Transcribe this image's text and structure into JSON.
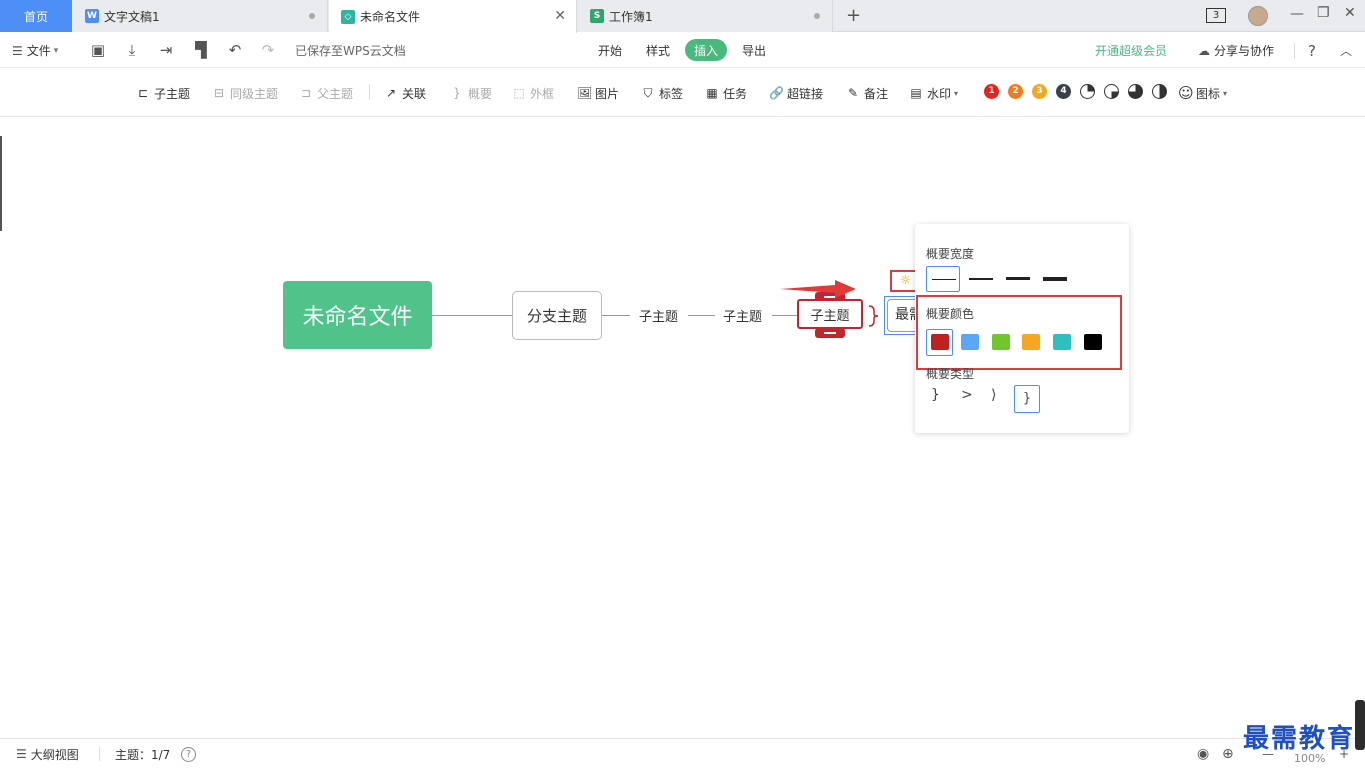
{
  "tabs": {
    "home": "首页",
    "doc1": "文字文稿1",
    "doc2": "未命名文件",
    "doc3": "工作簿1",
    "new_tab": "+",
    "window_count": "3"
  },
  "menu": {
    "file": "文件",
    "saved_status": "已保存至WPS云文档",
    "start": "开始",
    "style": "样式",
    "insert": "插入",
    "export": "导出",
    "vip": "开通超级会员",
    "share": "分享与协作",
    "help": "?"
  },
  "toolbar": {
    "subtopic": "子主题",
    "sibling": "同级主题",
    "parent": "父主题",
    "relation": "关联",
    "summary": "概要",
    "frame": "外框",
    "image": "图片",
    "tag": "标签",
    "task": "任务",
    "hyperlink": "超链接",
    "note": "备注",
    "watermark": "水印",
    "priorities": [
      "1",
      "2",
      "3",
      "4"
    ],
    "priority_colors": [
      "#e5241c",
      "#f57a1b",
      "#f5a623",
      "#3a3f4b"
    ],
    "icon": "图标"
  },
  "mindmap": {
    "root": "未命名文件",
    "branch": "分支主题",
    "sub1": "子主题",
    "sub2": "子主题",
    "selected": "子主题",
    "summary_partial": "最需"
  },
  "panel": {
    "width_label": "概要宽度",
    "color_label": "概要颜色",
    "type_label": "概要类型",
    "colors": [
      "#c0201f",
      "#5aa8f5",
      "#72c62d",
      "#f5a623",
      "#30bfbf",
      "#000000"
    ],
    "types": [
      "}",
      ">",
      "⟩",
      "}"
    ]
  },
  "status": {
    "outline": "大纲视图",
    "topics": "主题：1/7",
    "zoom": "100%"
  },
  "watermark_text": "最需教育",
  "colors": {
    "accent": "#4ab97d",
    "highlight": "#e03a3a",
    "home_tab": "#4e8ef7"
  }
}
